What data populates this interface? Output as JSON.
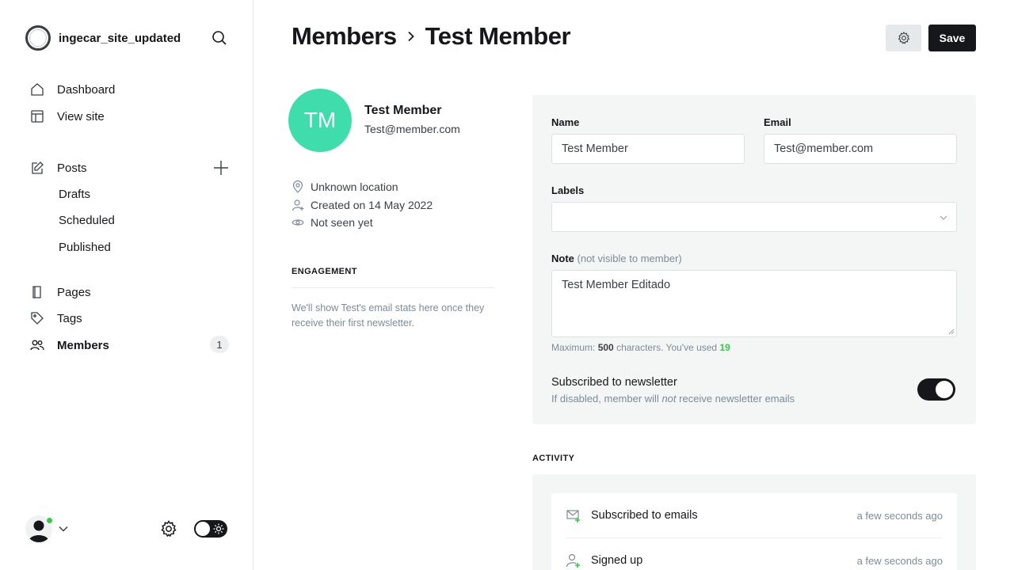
{
  "sidebar": {
    "site_name": "ingecar_site_updated",
    "nav": [
      {
        "label": "Dashboard",
        "icon": "home-icon"
      },
      {
        "label": "View site",
        "icon": "layout-icon"
      }
    ],
    "posts": {
      "label": "Posts",
      "icon": "edit-icon",
      "subitems": [
        "Drafts",
        "Scheduled",
        "Published"
      ]
    },
    "nav2": [
      {
        "label": "Pages",
        "icon": "page-icon"
      },
      {
        "label": "Tags",
        "icon": "tag-icon"
      },
      {
        "label": "Members",
        "icon": "members-icon",
        "count": "1"
      }
    ]
  },
  "header": {
    "breadcrumb_parent": "Members",
    "breadcrumb_current": "Test Member",
    "save_label": "Save"
  },
  "member": {
    "initials": "TM",
    "name": "Test Member",
    "email": "Test@member.com",
    "location": "Unknown location",
    "created": "Created on 14 May 2022",
    "seen": "Not seen yet",
    "avatar_color": "#3eddab"
  },
  "engagement": {
    "title": "ENGAGEMENT",
    "text": "We'll show Test's email stats here once they receive their first newsletter."
  },
  "form": {
    "name_label": "Name",
    "name_value": "Test Member",
    "email_label": "Email",
    "email_value": "Test@member.com",
    "labels_label": "Labels",
    "labels_value": "",
    "note_label": "Note",
    "note_muted": "(not visible to member)",
    "note_value": "Test Member Editado",
    "hint_prefix": "Maximum:",
    "hint_max": "500",
    "hint_mid": "characters. You've used",
    "hint_used": "19",
    "newsletter_title": "Subscribed to newsletter",
    "newsletter_sub_1": "If disabled, member will",
    "newsletter_sub_em": "not",
    "newsletter_sub_2": "receive newsletter emails",
    "newsletter_enabled": true
  },
  "activity": {
    "title": "ACTIVITY",
    "items": [
      {
        "label": "Subscribed to emails",
        "time": "a few seconds ago",
        "icon": "mail-plus-icon"
      },
      {
        "label": "Signed up",
        "time": "a few seconds ago",
        "icon": "user-plus-icon"
      }
    ]
  },
  "colors": {
    "accent_green": "#30cf43",
    "dark": "#15171a"
  }
}
